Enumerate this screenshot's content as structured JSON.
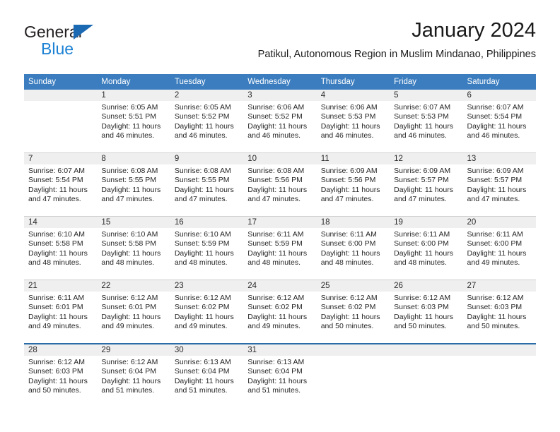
{
  "brand": {
    "name_part1": "General",
    "name_part2": "Blue",
    "triangle_color": "#1b68b3",
    "blue_color": "#1b81d4"
  },
  "header": {
    "month_title": "January 2024",
    "location": "Patikul, Autonomous Region in Muslim Mindanao, Philippines"
  },
  "theme": {
    "header_bg": "#3b7dbf",
    "daynum_bg": "#efefef",
    "row_divider": "#d0d0d0",
    "last_row_divider": "#2a6ca8"
  },
  "weekdays": [
    "Sunday",
    "Monday",
    "Tuesday",
    "Wednesday",
    "Thursday",
    "Friday",
    "Saturday"
  ],
  "labels": {
    "sunrise_prefix": "Sunrise:",
    "sunset_prefix": "Sunset:",
    "daylight_prefix": "Daylight:"
  },
  "weeks": [
    [
      {
        "day": "",
        "sunrise": "",
        "sunset": "",
        "daylight": "",
        "empty": true
      },
      {
        "day": "1",
        "sunrise": "Sunrise: 6:05 AM",
        "sunset": "Sunset: 5:51 PM",
        "daylight": "Daylight: 11 hours and 46 minutes."
      },
      {
        "day": "2",
        "sunrise": "Sunrise: 6:05 AM",
        "sunset": "Sunset: 5:52 PM",
        "daylight": "Daylight: 11 hours and 46 minutes."
      },
      {
        "day": "3",
        "sunrise": "Sunrise: 6:06 AM",
        "sunset": "Sunset: 5:52 PM",
        "daylight": "Daylight: 11 hours and 46 minutes."
      },
      {
        "day": "4",
        "sunrise": "Sunrise: 6:06 AM",
        "sunset": "Sunset: 5:53 PM",
        "daylight": "Daylight: 11 hours and 46 minutes."
      },
      {
        "day": "5",
        "sunrise": "Sunrise: 6:07 AM",
        "sunset": "Sunset: 5:53 PM",
        "daylight": "Daylight: 11 hours and 46 minutes."
      },
      {
        "day": "6",
        "sunrise": "Sunrise: 6:07 AM",
        "sunset": "Sunset: 5:54 PM",
        "daylight": "Daylight: 11 hours and 46 minutes."
      }
    ],
    [
      {
        "day": "7",
        "sunrise": "Sunrise: 6:07 AM",
        "sunset": "Sunset: 5:54 PM",
        "daylight": "Daylight: 11 hours and 47 minutes."
      },
      {
        "day": "8",
        "sunrise": "Sunrise: 6:08 AM",
        "sunset": "Sunset: 5:55 PM",
        "daylight": "Daylight: 11 hours and 47 minutes."
      },
      {
        "day": "9",
        "sunrise": "Sunrise: 6:08 AM",
        "sunset": "Sunset: 5:55 PM",
        "daylight": "Daylight: 11 hours and 47 minutes."
      },
      {
        "day": "10",
        "sunrise": "Sunrise: 6:08 AM",
        "sunset": "Sunset: 5:56 PM",
        "daylight": "Daylight: 11 hours and 47 minutes."
      },
      {
        "day": "11",
        "sunrise": "Sunrise: 6:09 AM",
        "sunset": "Sunset: 5:56 PM",
        "daylight": "Daylight: 11 hours and 47 minutes."
      },
      {
        "day": "12",
        "sunrise": "Sunrise: 6:09 AM",
        "sunset": "Sunset: 5:57 PM",
        "daylight": "Daylight: 11 hours and 47 minutes."
      },
      {
        "day": "13",
        "sunrise": "Sunrise: 6:09 AM",
        "sunset": "Sunset: 5:57 PM",
        "daylight": "Daylight: 11 hours and 47 minutes."
      }
    ],
    [
      {
        "day": "14",
        "sunrise": "Sunrise: 6:10 AM",
        "sunset": "Sunset: 5:58 PM",
        "daylight": "Daylight: 11 hours and 48 minutes."
      },
      {
        "day": "15",
        "sunrise": "Sunrise: 6:10 AM",
        "sunset": "Sunset: 5:58 PM",
        "daylight": "Daylight: 11 hours and 48 minutes."
      },
      {
        "day": "16",
        "sunrise": "Sunrise: 6:10 AM",
        "sunset": "Sunset: 5:59 PM",
        "daylight": "Daylight: 11 hours and 48 minutes."
      },
      {
        "day": "17",
        "sunrise": "Sunrise: 6:11 AM",
        "sunset": "Sunset: 5:59 PM",
        "daylight": "Daylight: 11 hours and 48 minutes."
      },
      {
        "day": "18",
        "sunrise": "Sunrise: 6:11 AM",
        "sunset": "Sunset: 6:00 PM",
        "daylight": "Daylight: 11 hours and 48 minutes."
      },
      {
        "day": "19",
        "sunrise": "Sunrise: 6:11 AM",
        "sunset": "Sunset: 6:00 PM",
        "daylight": "Daylight: 11 hours and 48 minutes."
      },
      {
        "day": "20",
        "sunrise": "Sunrise: 6:11 AM",
        "sunset": "Sunset: 6:00 PM",
        "daylight": "Daylight: 11 hours and 49 minutes."
      }
    ],
    [
      {
        "day": "21",
        "sunrise": "Sunrise: 6:11 AM",
        "sunset": "Sunset: 6:01 PM",
        "daylight": "Daylight: 11 hours and 49 minutes."
      },
      {
        "day": "22",
        "sunrise": "Sunrise: 6:12 AM",
        "sunset": "Sunset: 6:01 PM",
        "daylight": "Daylight: 11 hours and 49 minutes."
      },
      {
        "day": "23",
        "sunrise": "Sunrise: 6:12 AM",
        "sunset": "Sunset: 6:02 PM",
        "daylight": "Daylight: 11 hours and 49 minutes."
      },
      {
        "day": "24",
        "sunrise": "Sunrise: 6:12 AM",
        "sunset": "Sunset: 6:02 PM",
        "daylight": "Daylight: 11 hours and 49 minutes."
      },
      {
        "day": "25",
        "sunrise": "Sunrise: 6:12 AM",
        "sunset": "Sunset: 6:02 PM",
        "daylight": "Daylight: 11 hours and 50 minutes."
      },
      {
        "day": "26",
        "sunrise": "Sunrise: 6:12 AM",
        "sunset": "Sunset: 6:03 PM",
        "daylight": "Daylight: 11 hours and 50 minutes."
      },
      {
        "day": "27",
        "sunrise": "Sunrise: 6:12 AM",
        "sunset": "Sunset: 6:03 PM",
        "daylight": "Daylight: 11 hours and 50 minutes."
      }
    ],
    [
      {
        "day": "28",
        "sunrise": "Sunrise: 6:12 AM",
        "sunset": "Sunset: 6:03 PM",
        "daylight": "Daylight: 11 hours and 50 minutes."
      },
      {
        "day": "29",
        "sunrise": "Sunrise: 6:12 AM",
        "sunset": "Sunset: 6:04 PM",
        "daylight": "Daylight: 11 hours and 51 minutes."
      },
      {
        "day": "30",
        "sunrise": "Sunrise: 6:13 AM",
        "sunset": "Sunset: 6:04 PM",
        "daylight": "Daylight: 11 hours and 51 minutes."
      },
      {
        "day": "31",
        "sunrise": "Sunrise: 6:13 AM",
        "sunset": "Sunset: 6:04 PM",
        "daylight": "Daylight: 11 hours and 51 minutes."
      },
      {
        "day": "",
        "sunrise": "",
        "sunset": "",
        "daylight": "",
        "empty": true
      },
      {
        "day": "",
        "sunrise": "",
        "sunset": "",
        "daylight": "",
        "empty": true
      },
      {
        "day": "",
        "sunrise": "",
        "sunset": "",
        "daylight": "",
        "empty": true
      }
    ]
  ]
}
